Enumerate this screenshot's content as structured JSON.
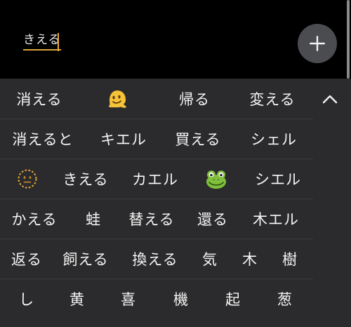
{
  "input": {
    "composing_text": "きえる"
  },
  "add_button": {
    "icon": "plus-icon"
  },
  "collapse_button": {
    "icon": "chevron-up-icon"
  },
  "colors": {
    "background": "#000000",
    "panel": "#2b2b2d",
    "divider": "#3b3b3e",
    "caret": "#e8a93a",
    "add_button": "#4b4c50"
  },
  "candidates": [
    [
      {
        "type": "text",
        "text": "消える"
      },
      {
        "type": "emoji",
        "icon": "melting-face-emoji"
      },
      {
        "type": "text",
        "text": "帰る"
      },
      {
        "type": "text",
        "text": "変える"
      }
    ],
    [
      {
        "type": "text",
        "text": "消えると"
      },
      {
        "type": "text",
        "text": "キエル"
      },
      {
        "type": "text",
        "text": "買える"
      },
      {
        "type": "text",
        "text": "シェル"
      }
    ],
    [
      {
        "type": "emoji",
        "icon": "dotted-line-face-emoji"
      },
      {
        "type": "text",
        "text": "きえる"
      },
      {
        "type": "text",
        "text": "カエル"
      },
      {
        "type": "emoji",
        "icon": "frog-emoji"
      },
      {
        "type": "text",
        "text": "シエル"
      }
    ],
    [
      {
        "type": "text",
        "text": "かえる"
      },
      {
        "type": "text",
        "text": "蛙"
      },
      {
        "type": "text",
        "text": "替える"
      },
      {
        "type": "text",
        "text": "還る"
      },
      {
        "type": "text",
        "text": "木エル"
      }
    ],
    [
      {
        "type": "text",
        "text": "返る"
      },
      {
        "type": "text",
        "text": "飼える"
      },
      {
        "type": "text",
        "text": "換える"
      },
      {
        "type": "text",
        "text": "気"
      },
      {
        "type": "text",
        "text": "木"
      },
      {
        "type": "text",
        "text": "樹"
      }
    ],
    [
      {
        "type": "text",
        "text": "し"
      },
      {
        "type": "text",
        "text": "黄"
      },
      {
        "type": "text",
        "text": "喜"
      },
      {
        "type": "text",
        "text": "機"
      },
      {
        "type": "text",
        "text": "起"
      },
      {
        "type": "text",
        "text": "葱"
      }
    ]
  ]
}
